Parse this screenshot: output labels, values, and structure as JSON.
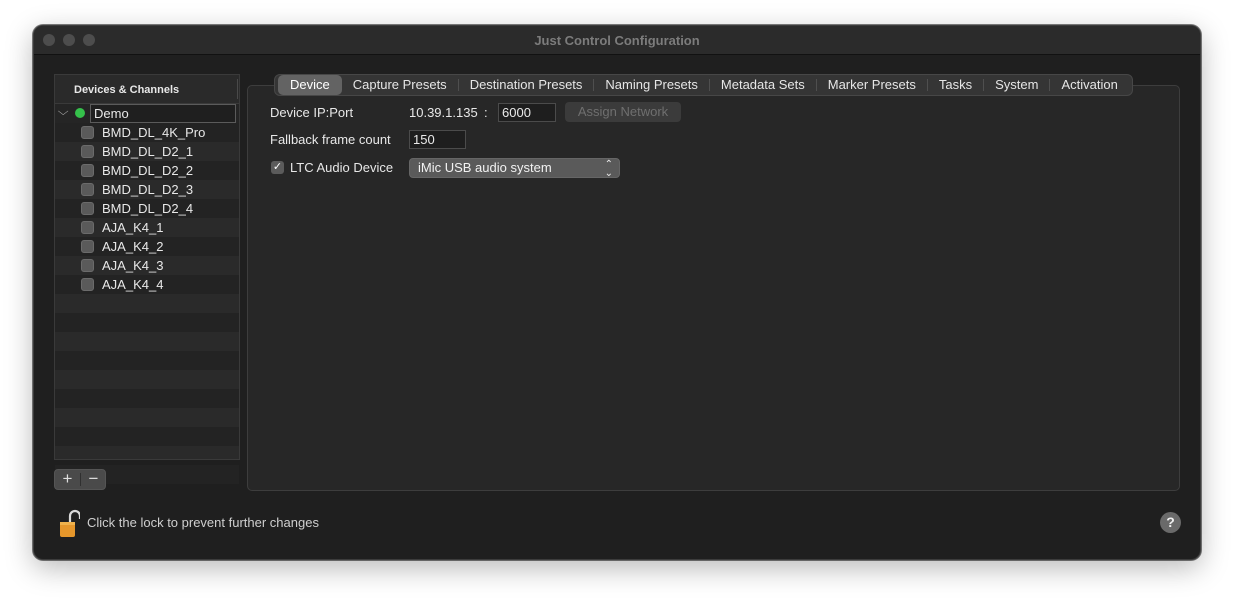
{
  "window": {
    "title": "Just Control Configuration"
  },
  "sidebar": {
    "header": "Devices & Channels",
    "root": {
      "label": "Demo",
      "status_color": "#35c14b"
    },
    "channels": [
      "BMD_DL_4K_Pro",
      "BMD_DL_D2_1",
      "BMD_DL_D2_2",
      "BMD_DL_D2_3",
      "BMD_DL_D2_4",
      "AJA_K4_1",
      "AJA_K4_2",
      "AJA_K4_3",
      "AJA_K4_4"
    ],
    "add_label": "+",
    "remove_label": "−"
  },
  "tabs": [
    "Device",
    "Capture Presets",
    "Destination Presets",
    "Naming Presets",
    "Metadata Sets",
    "Marker Presets",
    "Tasks",
    "System",
    "Activation"
  ],
  "active_tab": "Device",
  "device": {
    "ip_port_label": "Device IP:Port",
    "ip": "10.39.1.135",
    "ip_sep": ":",
    "port": "6000",
    "assign_network_label": "Assign Network",
    "fallback_label": "Fallback frame count",
    "fallback_value": "150",
    "ltc_label": "LTC Audio Device",
    "ltc_checked": true,
    "ltc_device": "iMic USB audio system"
  },
  "footer": {
    "lock_text": "Click the lock to prevent further changes",
    "help_label": "?"
  }
}
